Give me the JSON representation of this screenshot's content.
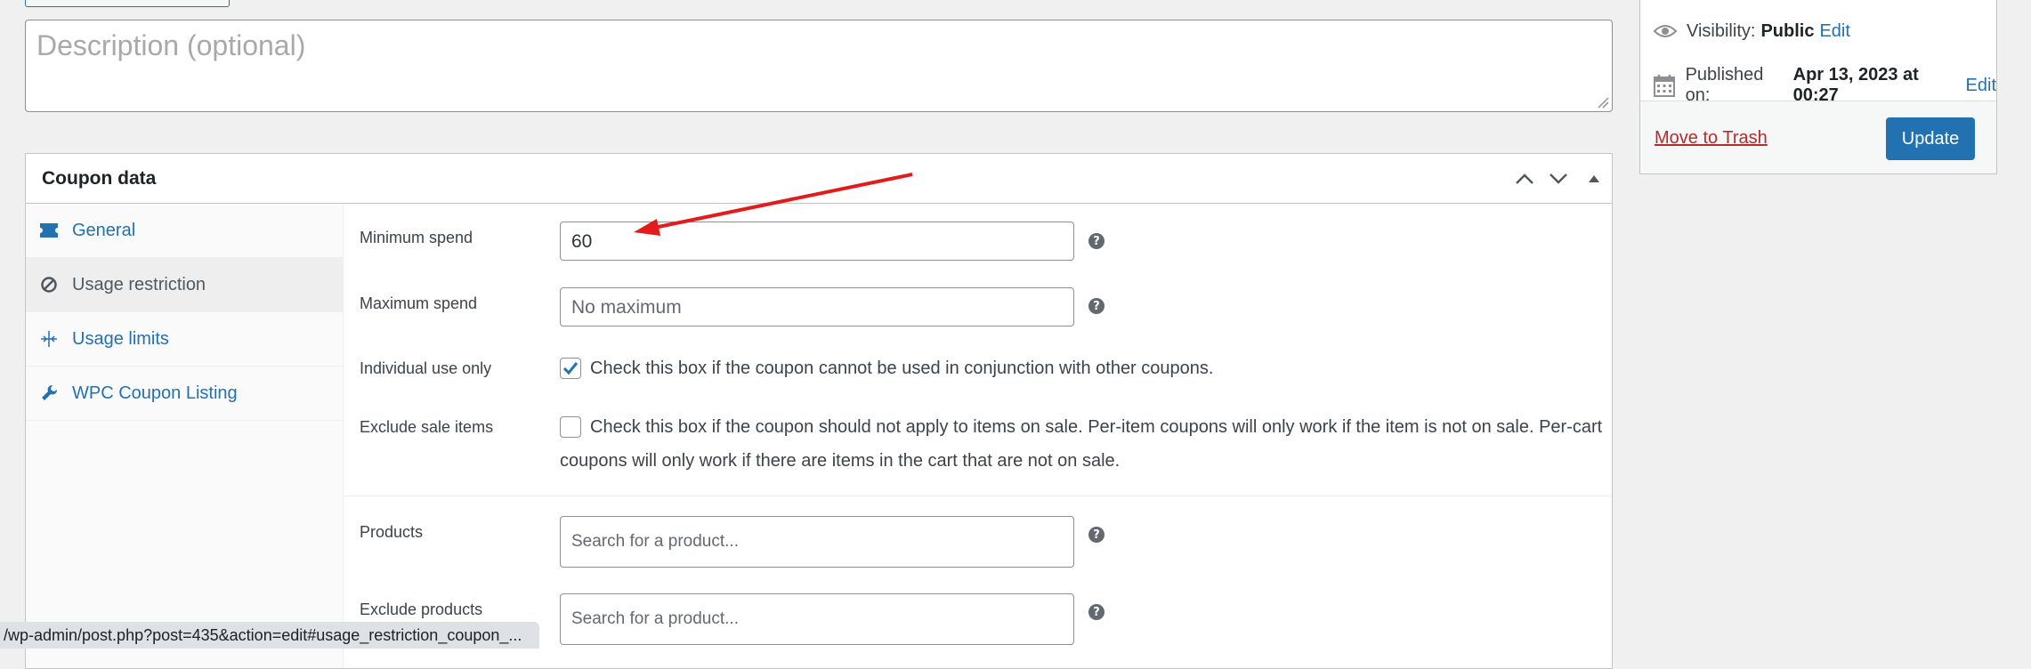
{
  "description": {
    "placeholder": "Description (optional)"
  },
  "coupon_panel": {
    "title": "Coupon data",
    "tabs": [
      {
        "label": "General",
        "icon": "ticket-icon",
        "active": false
      },
      {
        "label": "Usage restriction",
        "icon": "block-icon",
        "active": true
      },
      {
        "label": "Usage limits",
        "icon": "limits-icon",
        "active": false
      },
      {
        "label": "WPC Coupon Listing",
        "icon": "wrench-icon",
        "active": false
      }
    ],
    "fields": {
      "minimum_spend": {
        "label": "Minimum spend",
        "value": "60"
      },
      "maximum_spend": {
        "label": "Maximum spend",
        "placeholder": "No maximum"
      },
      "individual_use": {
        "label": "Individual use only",
        "checked": true,
        "text": "Check this box if the coupon cannot be used in conjunction with other coupons."
      },
      "exclude_sale": {
        "label": "Exclude sale items",
        "checked": false,
        "text_line1": "Check this box if the coupon should not apply to items on sale. Per-item coupons will only work if the item is not on sale. Per-cart",
        "text_line2": "coupons will only work if there are items in the cart that are not on sale."
      },
      "products": {
        "label": "Products",
        "placeholder": "Search for a product..."
      },
      "exclude_products": {
        "label": "Exclude products",
        "placeholder": "Search for a product..."
      }
    }
  },
  "publish": {
    "visibility_label": "Visibility:",
    "visibility_value": "Public",
    "visibility_edit": "Edit",
    "published_label": "Published on:",
    "published_value": "Apr 13, 2023 at 00:27",
    "published_edit": "Edit",
    "trash_label": "Move to Trash",
    "update_label": "Update"
  },
  "statusbar": {
    "url": "/wp-admin/post.php?post=435&action=edit#usage_restriction_coupon_..."
  },
  "colors": {
    "accent": "#2271b1",
    "annotation_arrow": "#e31b1b",
    "trash": "#b32d2e"
  }
}
